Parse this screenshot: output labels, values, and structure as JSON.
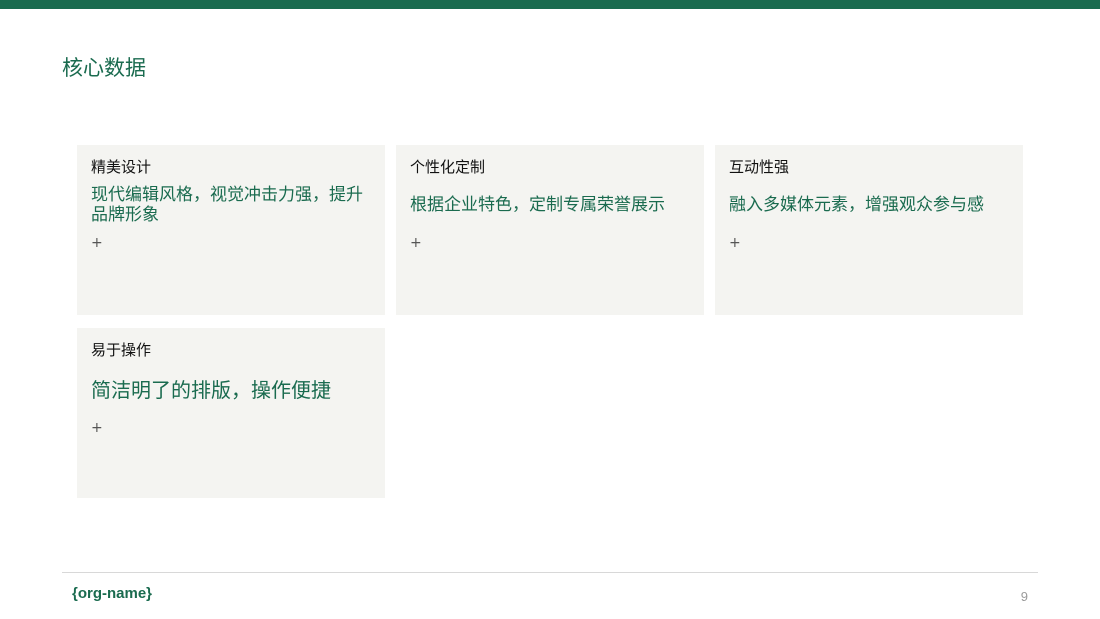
{
  "header": {
    "title": "核心数据"
  },
  "cards": [
    {
      "label": "精美设计",
      "value": "现代编辑风格，视觉冲击力强，提升品牌形象",
      "plus": "+"
    },
    {
      "label": "个性化定制",
      "value": "根据企业特色，定制专属荣誉展示",
      "plus": "+"
    },
    {
      "label": "互动性强",
      "value": "融入多媒体元素，增强观众参与感",
      "plus": "+"
    },
    {
      "label": "易于操作",
      "value": "简洁明了的排版，操作便捷",
      "plus": "+"
    }
  ],
  "footer": {
    "org": "{org-name}",
    "page_number": "9"
  },
  "colors": {
    "accent": "#1a6b4f",
    "card_background": "#f4f4f1"
  }
}
